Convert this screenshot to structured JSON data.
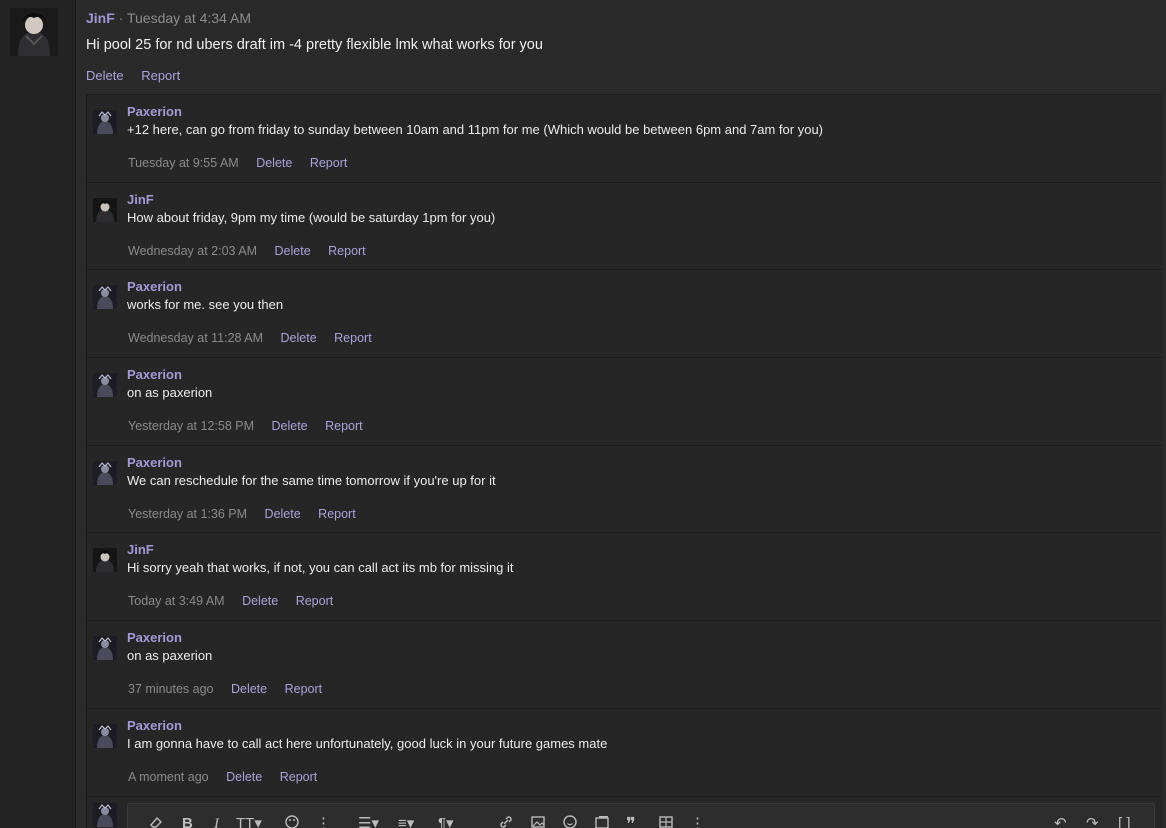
{
  "post": {
    "author": "JinF",
    "separator": "·",
    "time": "Tuesday at 4:34 AM",
    "body": "Hi pool 25 for nd ubers draft im -4 pretty flexible lmk what works for you",
    "delete_label": "Delete",
    "report_label": "Report"
  },
  "comments": [
    {
      "author": "Paxerion",
      "text": "+12 here, can go from friday to sunday between 10am and 11pm for me (Which would be between 6pm and 7am for you)",
      "time": "Tuesday at 9:55 AM",
      "delete_label": "Delete",
      "report_label": "Report"
    },
    {
      "author": "JinF",
      "text": "How about friday, 9pm my time (would be saturday 1pm for you)",
      "time": "Wednesday at 2:03 AM",
      "delete_label": "Delete",
      "report_label": "Report"
    },
    {
      "author": "Paxerion",
      "text": "works for me. see you then",
      "time": "Wednesday at 11:28 AM",
      "delete_label": "Delete",
      "report_label": "Report"
    },
    {
      "author": "Paxerion",
      "text": "on as paxerion",
      "time": "Yesterday at 12:58 PM",
      "delete_label": "Delete",
      "report_label": "Report"
    },
    {
      "author": "Paxerion",
      "text": "We can reschedule for the same time tomorrow if you're up for it",
      "time": "Yesterday at 1:36 PM",
      "delete_label": "Delete",
      "report_label": "Report"
    },
    {
      "author": "JinF",
      "text": "Hi sorry yeah that works, if not, you can call act its mb for missing it",
      "time": "Today at 3:49 AM",
      "delete_label": "Delete",
      "report_label": "Report"
    },
    {
      "author": "Paxerion",
      "text": "on as paxerion",
      "time": "37 minutes ago",
      "delete_label": "Delete",
      "report_label": "Report"
    },
    {
      "author": "Paxerion",
      "text": "I am gonna have to call act here unfortunately, good luck in your future games mate",
      "time": "A moment ago",
      "delete_label": "Delete",
      "report_label": "Report"
    }
  ],
  "toolbar_icons": [
    "eraser-icon",
    "bold-icon",
    "italic-icon",
    "text-size-icon",
    "palette-icon",
    "more-options-icon",
    "list-icon",
    "align-icon",
    "paragraph-icon",
    "link-icon",
    "image-icon",
    "emoji-icon",
    "media-icon",
    "quote-icon",
    "table-icon",
    "more-icon",
    "undo-icon",
    "redo-icon",
    "fullscreen-icon"
  ],
  "colors": {
    "accent_link": "#a9a3db",
    "author": "#9f97d2",
    "background": "#2a2a2a"
  }
}
